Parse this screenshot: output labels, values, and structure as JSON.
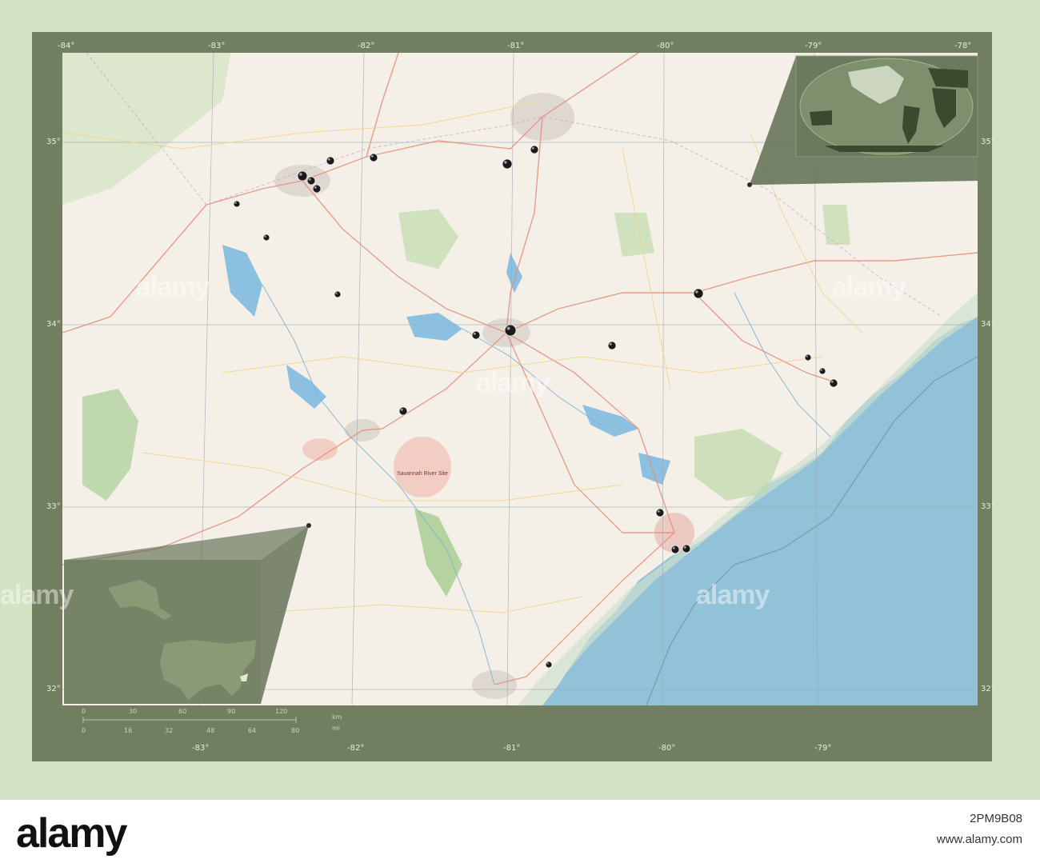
{
  "map": {
    "region": "South Carolina",
    "style": "open street map",
    "background_color": "#d3e2c4",
    "frame_color": "#717f60",
    "water_color": "#92c2d8",
    "land_color": "#f4efe7",
    "marker_count": 31
  },
  "longitude_labels_top": [
    "-84°",
    "-83°",
    "-82°",
    "-81°",
    "-80°",
    "-79°",
    "-78°"
  ],
  "longitude_labels_bottom": [
    "-83°",
    "-82°",
    "-81°",
    "-80°",
    "-79°"
  ],
  "latitude_labels_left": [
    "35°",
    "34°",
    "33°",
    "32°"
  ],
  "latitude_labels_right": [
    "35°",
    "34°",
    "33°",
    "32°"
  ],
  "place_labels": {
    "savannah_river_site": "Savannah River Site"
  },
  "scale_bar": {
    "km_ticks": [
      "0",
      "30",
      "60",
      "90",
      "120"
    ],
    "mi_ticks": [
      "0",
      "16",
      "32",
      "48",
      "64",
      "80"
    ],
    "km_unit": "km",
    "mi_unit": "mi"
  },
  "watermark": {
    "text": "alamy",
    "image_id": "2PM9B08",
    "site": "www.alamy.com"
  },
  "insets": {
    "globe": "world locator",
    "usa": "USA locator"
  }
}
